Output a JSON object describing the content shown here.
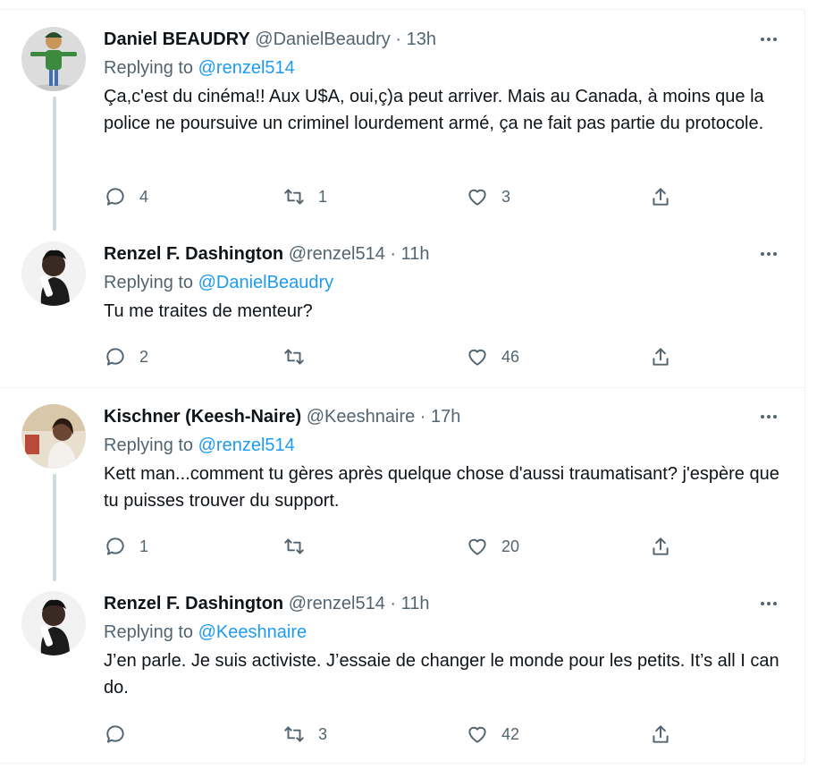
{
  "tweets": [
    {
      "display_name": "Daniel BEAUDRY",
      "handle": "@DanielBeaudry",
      "separator": "·",
      "time": "13h",
      "replying_label": "Replying to",
      "replying_to": "@renzel514",
      "text": "Ça,c'est du cinéma!! Aux U$A, oui,ç)a peut arriver. Mais au Canada, à moins que la police ne poursuive un criminel lourdement armé, ça ne fait pas partie du protocole.",
      "replies": "4",
      "retweets": "1",
      "likes": "3"
    },
    {
      "display_name": "Renzel F. Dashington",
      "handle": "@renzel514",
      "separator": "·",
      "time": "11h",
      "replying_label": "Replying to",
      "replying_to": "@DanielBeaudry",
      "text": "Tu me traites de menteur?",
      "replies": "2",
      "retweets": "",
      "likes": "46"
    },
    {
      "display_name": "Kischner (Keesh-Naire)",
      "handle": "@Keeshnaire",
      "separator": "·",
      "time": "17h",
      "replying_label": "Replying to",
      "replying_to": "@renzel514",
      "text": "Kett man...comment tu gères après quelque chose d'aussi traumatisant? j'espère que tu puisses trouver du support.",
      "replies": "1",
      "retweets": "",
      "likes": "20"
    },
    {
      "display_name": "Renzel F. Dashington",
      "handle": "@renzel514",
      "separator": "·",
      "time": "11h",
      "replying_label": "Replying to",
      "replying_to": "@Keeshnaire",
      "text": "J’en parle. Je suis activiste. J’essaie de changer le monde pour les petits. It’s all I can do.",
      "replies": "",
      "retweets": "3",
      "likes": "42"
    }
  ],
  "colors": {
    "link": "#1d9bf0",
    "secondary_text": "#536471",
    "primary_text": "#0f1419",
    "thread_line": "#cfd9de"
  },
  "icons": [
    "reply-icon",
    "retweet-icon",
    "like-icon",
    "share-icon",
    "more-icon"
  ]
}
